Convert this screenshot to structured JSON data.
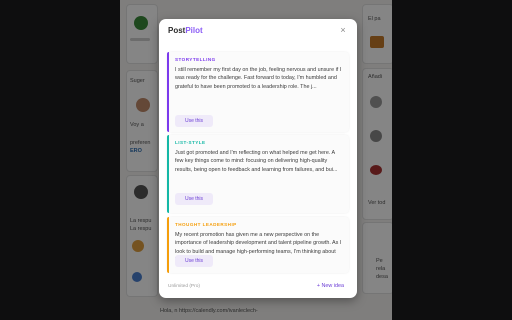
{
  "background": {
    "right_labels": [
      "El pa",
      "Añadi",
      "Ver tod",
      "Pe",
      "rela",
      "desa"
    ],
    "left_labels": [
      "Suger",
      "Voy a",
      "preferen",
      "La respu",
      "La respu"
    ],
    "bottom_text": "Hola, n https://calendly.com/ivanleclech-",
    "badge": "ERO"
  },
  "modal": {
    "logo_part1": "Post",
    "logo_part2": "Pilot",
    "close_symbol": "×",
    "cards": [
      {
        "kind": "STORYTELLING",
        "color": "#7c3aed",
        "text": "I still remember my first day on the job, feeling nervous and unsure if I was ready for the challenge. Fast forward to today, I'm humbled and grateful to have been promoted to a leadership role. The j...",
        "button": "Use this"
      },
      {
        "kind": "LIST-STYLE",
        "color": "#14b8a6",
        "text": "Just got promoted and I'm reflecting on what helped me get here. A few key things come to mind: focusing on delivering high-quality results, being open to feedback and learning from failures, and bui...",
        "button": "Use this"
      },
      {
        "kind": "THOUGHT LEADERSHIP",
        "color": "#f59e0b",
        "text": "My recent promotion has given me a new perspective on the importance of leadership development and talent pipeline growth. As I look to build and manage high-performing teams, I'm thinking about how t...",
        "button": "Use this"
      }
    ],
    "footer_left": "Unlimited (Pro)",
    "footer_right": "+ New idea"
  }
}
